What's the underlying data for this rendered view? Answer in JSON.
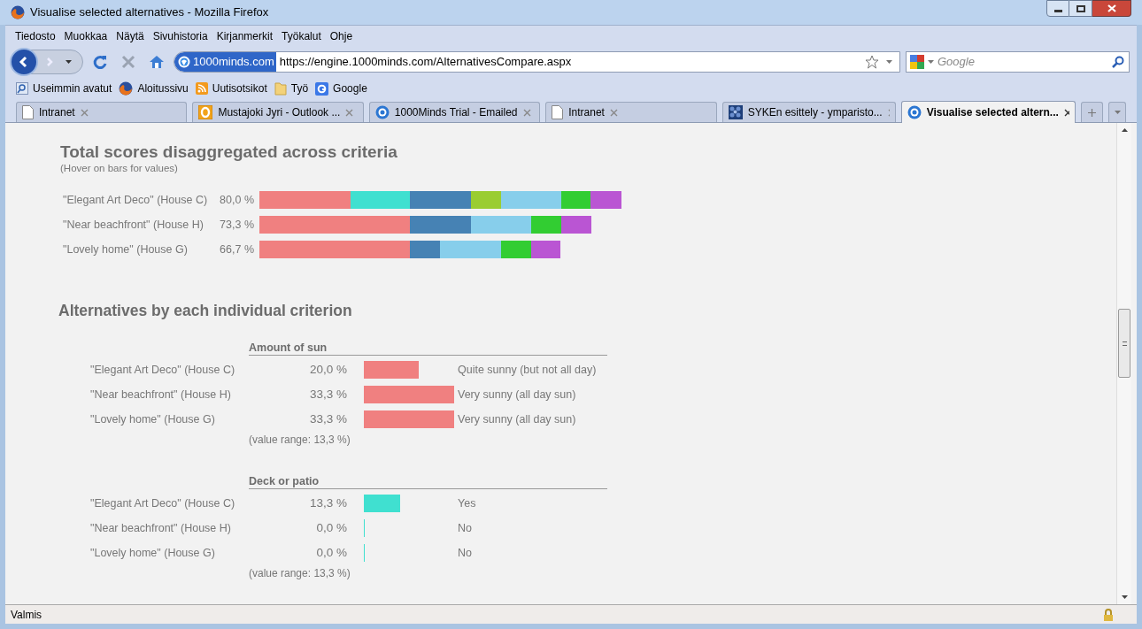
{
  "window": {
    "title": "Visualise selected alternatives - Mozilla Firefox"
  },
  "menu": [
    "Tiedosto",
    "Muokkaa",
    "Näytä",
    "Sivuhistoria",
    "Kirjanmerkit",
    "Työkalut",
    "Ohje"
  ],
  "toolbar": {
    "identity": "1000minds.com",
    "url": "https://engine.1000minds.com/AlternativesCompare.aspx",
    "search_placeholder": "Google"
  },
  "bookmarks": [
    {
      "kind": "smart",
      "label": "Useimmin avatut"
    },
    {
      "kind": "firefox",
      "label": "Aloitussivu"
    },
    {
      "kind": "feed",
      "label": "Uutisotsikot"
    },
    {
      "kind": "folder",
      "label": "Työ"
    },
    {
      "kind": "google",
      "label": "Google"
    }
  ],
  "tabs": [
    {
      "label": "Intranet",
      "kind": "page",
      "selected": false
    },
    {
      "label": "Mustajoki Jyri - Outlook ...",
      "kind": "outlook",
      "selected": false
    },
    {
      "label": "1000Minds Trial - Emailed",
      "kind": "globe",
      "selected": false
    },
    {
      "label": "Intranet",
      "kind": "page",
      "selected": false
    },
    {
      "label": "SYKEn esittely - ymparisto...",
      "kind": "mosaic",
      "selected": false
    },
    {
      "label": "Visualise selected altern...",
      "kind": "globe",
      "selected": true
    }
  ],
  "total": {
    "title": "Total scores disaggregated across criteria",
    "subtitle": "(Hover on bars for values)",
    "rows": [
      {
        "name": "\"Elegant Art Deco\" (House C)",
        "score": "80,0 %",
        "segments": [
          {
            "color": "#f08080"
          },
          {
            "color": "#40e0d0"
          },
          {
            "color": "#4682b4"
          },
          {
            "color": "#9acd32"
          },
          {
            "color": "#87ceeb"
          },
          {
            "color": "#32cd32"
          },
          {
            "color": "#ba55d3"
          }
        ]
      },
      {
        "name": "\"Near beachfront\" (House H)",
        "score": "73,3 %",
        "segments": [
          {
            "color": "#f08080"
          },
          {
            "color": "#4682b4"
          },
          {
            "color": "#87ceeb"
          },
          {
            "color": "#32cd32"
          },
          {
            "color": "#ba55d3"
          }
        ]
      },
      {
        "name": "\"Lovely home\" (House G)",
        "score": "66,7 %",
        "segments": [
          {
            "color": "#f08080"
          },
          {
            "color": "#4682b4"
          },
          {
            "color": "#87ceeb"
          },
          {
            "color": "#32cd32"
          },
          {
            "color": "#ba55d3"
          }
        ]
      }
    ]
  },
  "individual": {
    "title": "Alternatives by each individual criterion",
    "criteria": [
      {
        "name": "Amount of sun",
        "color": "#f08080",
        "range": "(value range: 13,3 %)",
        "rows": [
          {
            "name": "\"Elegant Art Deco\" (House C)",
            "score": "20,0 %",
            "description": "Quite sunny (but not all day)"
          },
          {
            "name": "\"Near beachfront\" (House H)",
            "score": "33,3 %",
            "description": "Very sunny (all day sun)"
          },
          {
            "name": "\"Lovely home\" (House G)",
            "score": "33,3 %",
            "description": "Very sunny (all day sun)"
          }
        ]
      },
      {
        "name": "Deck or patio",
        "color": "#40e0d0",
        "range": "(value range: 13,3 %)",
        "rows": [
          {
            "name": "\"Elegant Art Deco\" (House C)",
            "score": "13,3 %",
            "description": "Yes"
          },
          {
            "name": "\"Near beachfront\" (House H)",
            "score": "0,0 %",
            "description": "No"
          },
          {
            "name": "\"Lovely home\" (House G)",
            "score": "0,0 %",
            "description": "No"
          }
        ]
      }
    ]
  },
  "status_bar": "Valmis"
}
